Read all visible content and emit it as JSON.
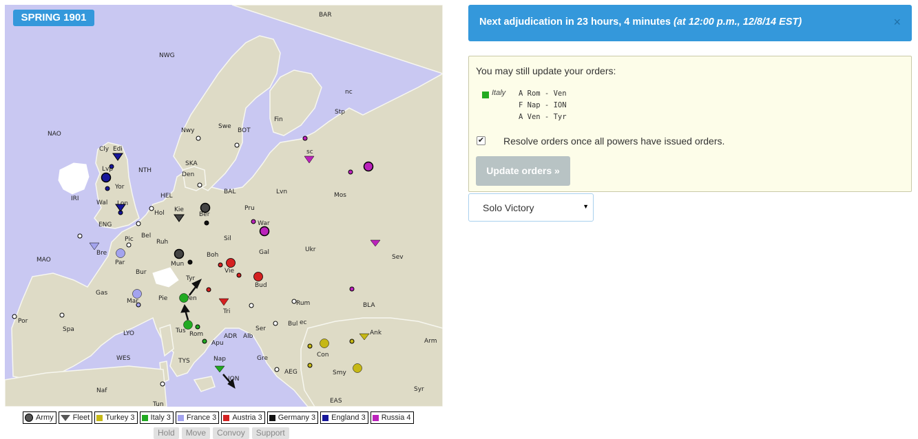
{
  "map": {
    "season": "SPRING 1901",
    "sea_labels": [
      "BAR",
      "NWG",
      "NAO",
      "NTH",
      "IRI",
      "MAO",
      "ENG",
      "HEL",
      "SKA",
      "BAL",
      "BOT",
      "LYO",
      "WES",
      "TYS",
      "ION",
      "ADR",
      "AEG",
      "EAS",
      "BLA"
    ],
    "land_labels": [
      "nc",
      "Stp",
      "Fin",
      "Nwy",
      "Swe",
      "Cly",
      "Edi",
      "Lvp",
      "Yor",
      "Wal",
      "Lon",
      "Den",
      "Kie",
      "Ber",
      "Pru",
      "Lvn",
      "Mos",
      "sc",
      "Hol",
      "Bel",
      "Pic",
      "Bre",
      "Par",
      "Ruh",
      "Mun",
      "Sil",
      "War",
      "Ukr",
      "Gal",
      "Boh",
      "Sev",
      "Vie",
      "Bud",
      "Tyr",
      "Bur",
      "Gas",
      "Mar",
      "Pie",
      "Ven",
      "Tus",
      "Rom",
      "Apu",
      "Nap",
      "Tri",
      "Ser",
      "Rum",
      "Bul",
      "ec",
      "Alb",
      "Gre",
      "Con",
      "Ank",
      "Smy",
      "Arm",
      "Syr",
      "Spa",
      "Por",
      "Naf",
      "Tun"
    ],
    "colors": {
      "sea": "#c9c8f2",
      "land": "#dedbc6",
      "turkey": "#c6b816",
      "italy": "#22aa22",
      "france": "#a3a3ee",
      "austria": "#d42121",
      "germany": "#222222",
      "england": "#16169a",
      "russia": "#bb22bb",
      "neutral": "#ffffff"
    }
  },
  "legend": {
    "army": "Army",
    "fleet": "Fleet",
    "powers": [
      {
        "name": "Turkey 3",
        "color": "#c6b816"
      },
      {
        "name": "Italy 3",
        "color": "#22aa22"
      },
      {
        "name": "France 3",
        "color": "#a3a3ee"
      },
      {
        "name": "Austria 3",
        "color": "#d42121"
      },
      {
        "name": "Germany 3",
        "color": "#111111"
      },
      {
        "name": "England 3",
        "color": "#16169a"
      },
      {
        "name": "Russia 4",
        "color": "#bb22bb"
      }
    ]
  },
  "order_buttons": [
    "Hold",
    "Move",
    "Convoy",
    "Support"
  ],
  "adjudication": {
    "text": "Next adjudication in 23 hours, 4 minutes",
    "detail": "(at 12:00 p.m., 12/8/14 EST)",
    "close": "×"
  },
  "orders": {
    "title": "You may still update your orders:",
    "power": "Italy",
    "power_color": "#22aa22",
    "lines": [
      "A Rom - Ven",
      "F Nap - ION",
      "A Ven - Tyr"
    ],
    "resolve_checked": true,
    "resolve_label": "Resolve orders once all powers have issued orders.",
    "update_button": "Update orders »"
  },
  "victory_select": {
    "selected": "Solo Victory"
  }
}
